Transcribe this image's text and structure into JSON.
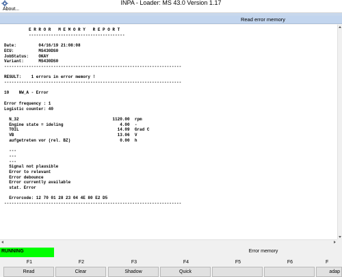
{
  "window": {
    "title": "INPA - Loader:  MS 43.0 Version 1.17",
    "icon": "gear-icon"
  },
  "menu": {
    "about_label": "About..."
  },
  "header": {
    "title": "Read error memory"
  },
  "report": {
    "lines": [
      "          E R R O R   M E M O R Y   R E P O R T",
      "          ---------------------------------------",
      "",
      "Date:         04/16/19 21:08:08",
      "ECU:          MS430DS0",
      "JobStatus:    OKAY",
      "Variant:      MS430DS0",
      "------------------------------------------------------------------------",
      "",
      "RESULT:    1 errors in error memory !",
      "------------------------------------------------------------------------",
      "",
      "10    NW_A - Error",
      "",
      "Error frequency : 1",
      "Logistic counter: 40",
      "",
      "  N_32                                      1120.00  rpm",
      "  Engine state = ideling                       4.00  -",
      "  TOIL                                        14.09  Grad C",
      "  VB                                          13.06  V",
      "  aufgetreten vor (rel. BZ)                    0.00  h",
      "",
      "  ---",
      "  ---",
      "  ---",
      "  Signal not plausible",
      "  Error to relevant",
      "  Error debounce",
      "  Error currently available",
      "  stat. Error",
      "",
      "  Errorcode: 12 70 01 28 23 04 4E 80 E2 D5",
      "------------------------------------------------------------------------"
    ]
  },
  "status": {
    "state": "RUNNING",
    "state_color": "#00ff00",
    "mode": "Error memory"
  },
  "function_keys": [
    {
      "key": "F1",
      "label": "Read"
    },
    {
      "key": "F2",
      "label": "Clear"
    },
    {
      "key": "F3",
      "label": "Shadow"
    },
    {
      "key": "F4",
      "label": "Quick"
    },
    {
      "key": "F5",
      "label": ""
    },
    {
      "key": "F6",
      "label": ""
    },
    {
      "key": "F",
      "label": "adap"
    }
  ],
  "colors": {
    "header_band": "#c2d5ee",
    "report_background": "#ffffff",
    "running": "#00ff00"
  }
}
